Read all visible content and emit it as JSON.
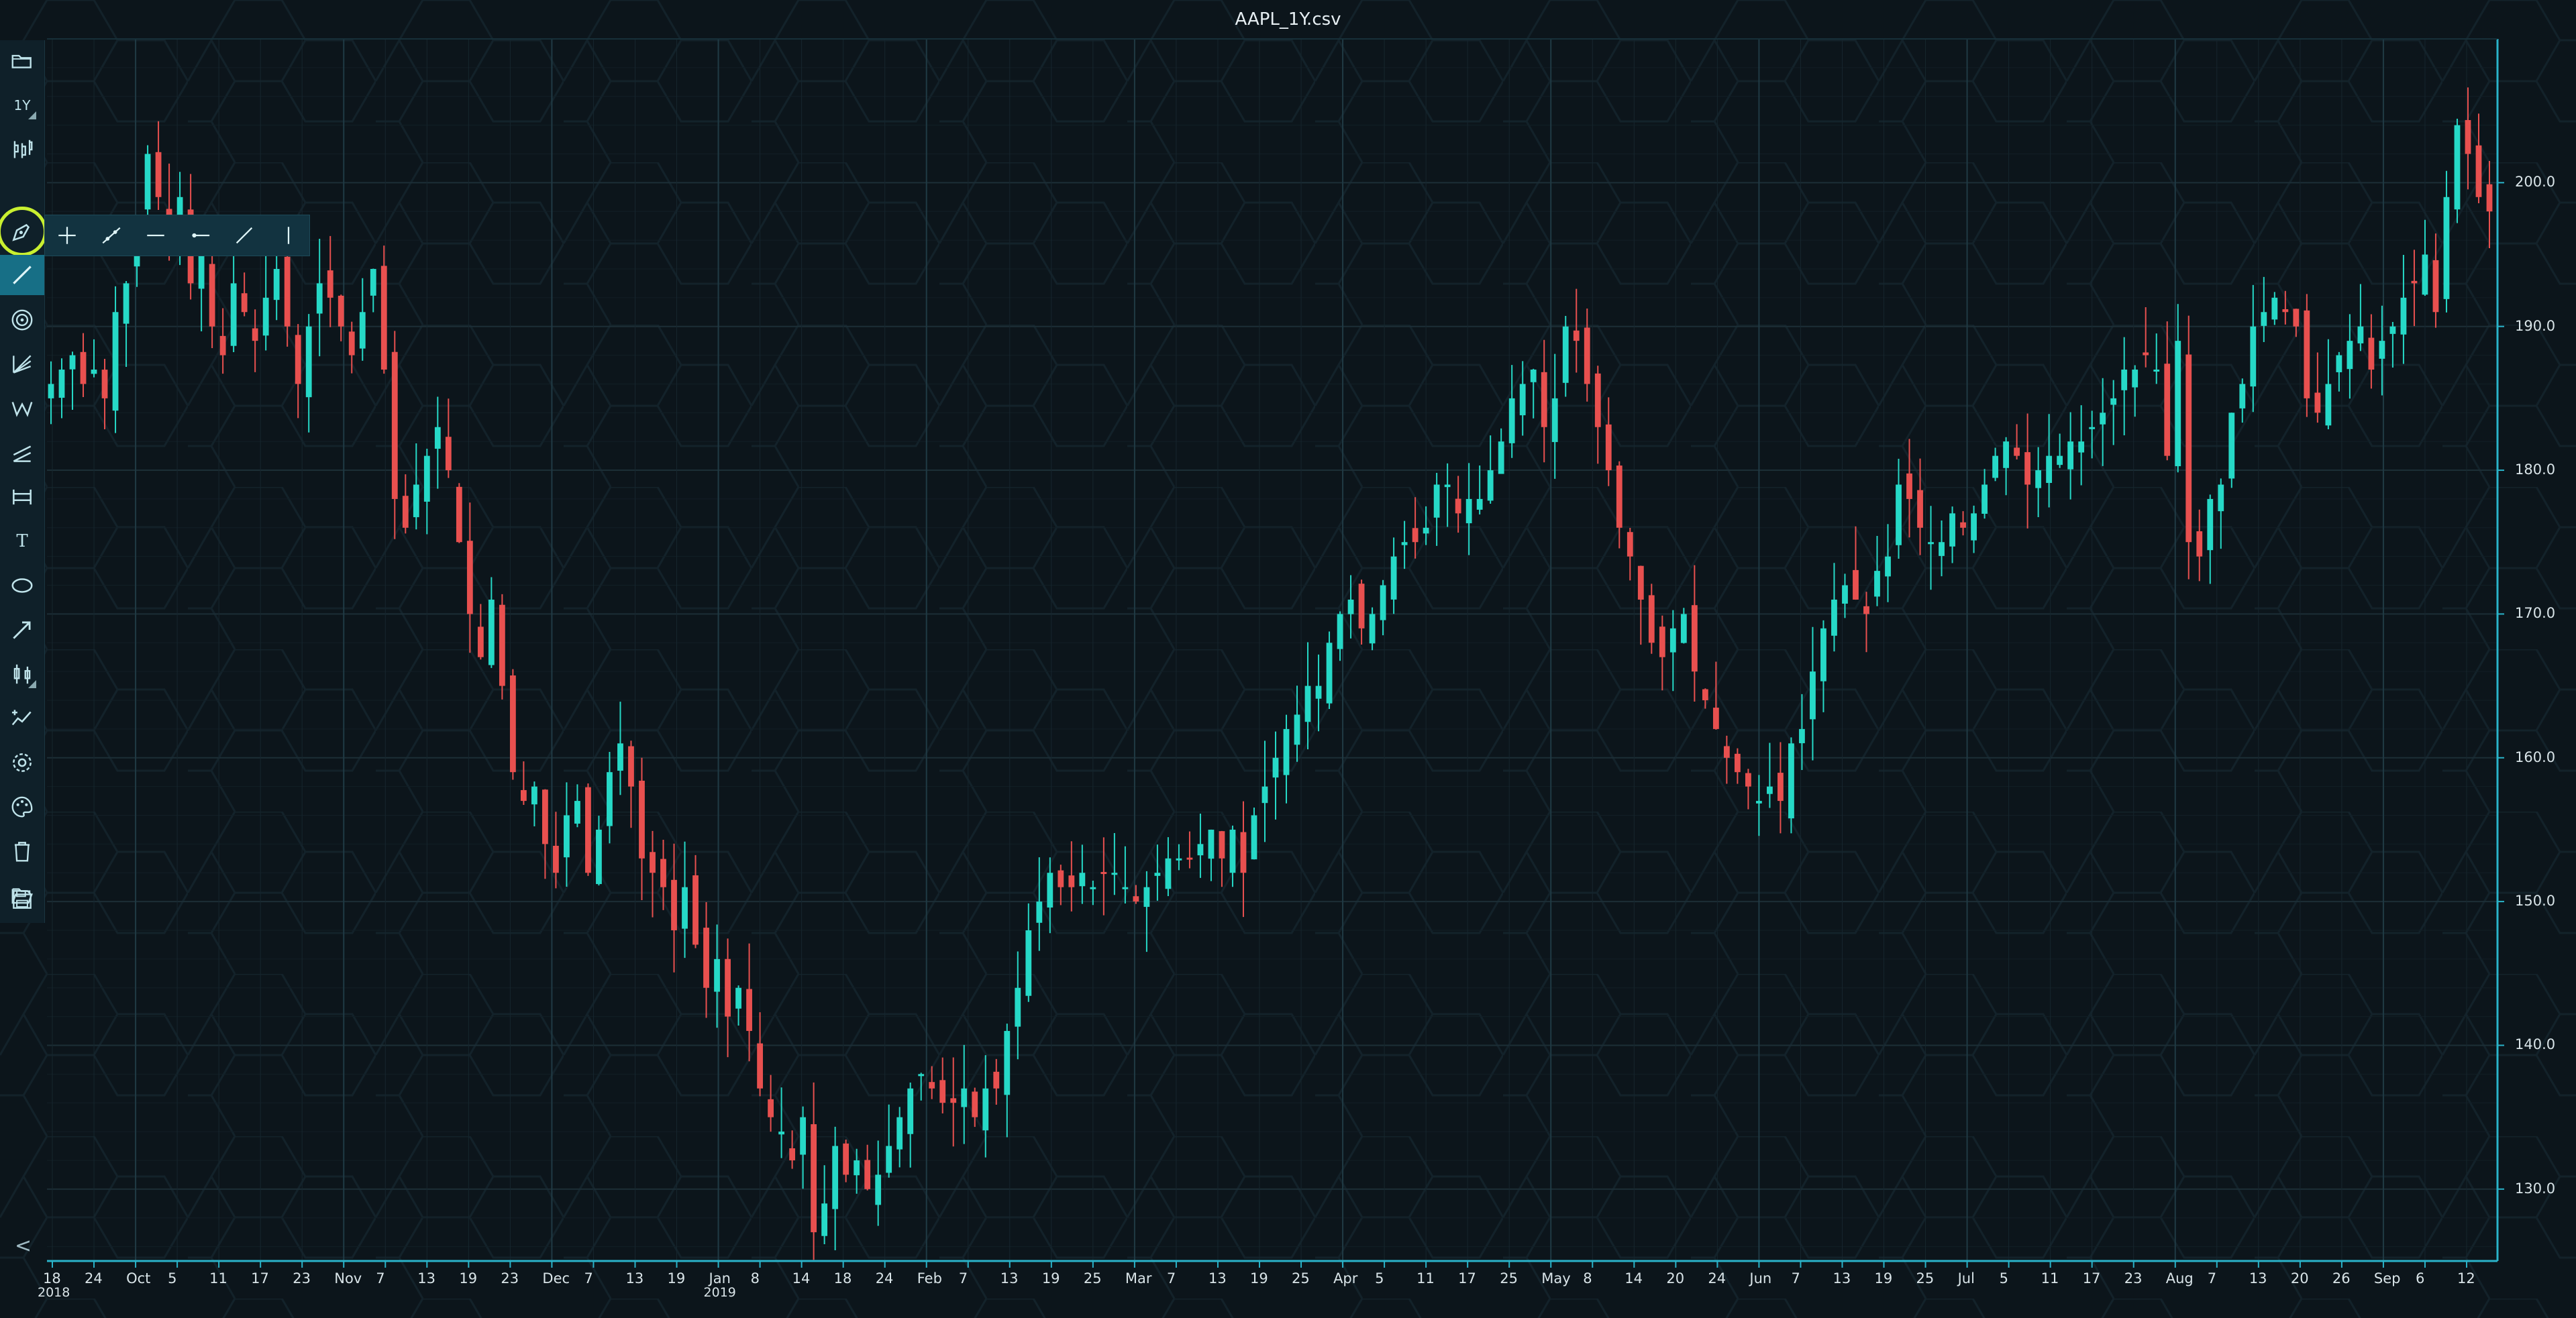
{
  "window": {
    "title": "AAPL_1Y.csv"
  },
  "toolbar": {
    "items": [
      {
        "name": "open-chart-icon",
        "label": ""
      },
      {
        "name": "timeframe-button",
        "label": "1Y"
      },
      {
        "name": "chart-type-icon",
        "label": ""
      },
      {
        "name": "drawing-tools-icon",
        "label": ""
      },
      {
        "name": "line-tool-icon",
        "label": ""
      },
      {
        "name": "fib-circle-icon",
        "label": ""
      },
      {
        "name": "fan-tool-icon",
        "label": ""
      },
      {
        "name": "wave-tool-icon",
        "label": ""
      },
      {
        "name": "channel-tool-icon",
        "label": ""
      },
      {
        "name": "range-tool-icon",
        "label": ""
      },
      {
        "name": "text-tool-icon",
        "label": "T"
      },
      {
        "name": "ellipse-tool-icon",
        "label": ""
      },
      {
        "name": "arrow-tool-icon",
        "label": ""
      },
      {
        "name": "candles-icon",
        "label": ""
      },
      {
        "name": "indicators-icon",
        "label": ""
      },
      {
        "name": "settings-icon",
        "label": ""
      },
      {
        "name": "palette-icon",
        "label": ""
      },
      {
        "name": "trash-icon",
        "label": ""
      },
      {
        "name": "folder-open-icon",
        "label": ""
      },
      {
        "name": "save-icon",
        "label": ""
      }
    ]
  },
  "subtoolbar": {
    "items": [
      "crosshair-icon",
      "segment-icon",
      "horizontal-line-icon",
      "horizontal-ray-icon",
      "trend-line-icon",
      "vertical-line-icon"
    ]
  },
  "collapse_label": "<",
  "colors": {
    "up": "#26d9c7",
    "down": "#e8504f",
    "grid": "#1c2e36",
    "axis": "#2ab3c9"
  },
  "chart_data": {
    "type": "candlestick",
    "title": "AAPL_1Y.csv",
    "ylim": [
      125,
      210
    ],
    "yticks": [
      "130.0",
      "140.0",
      "150.0",
      "160.0",
      "170.0",
      "180.0",
      "190.0",
      "200.0"
    ],
    "xticks": [
      {
        "label": "18",
        "year": "2018"
      },
      {
        "label": "24"
      },
      {
        "label": "Oct"
      },
      {
        "label": "5"
      },
      {
        "label": "11"
      },
      {
        "label": "17"
      },
      {
        "label": "23"
      },
      {
        "label": "Nov"
      },
      {
        "label": "7"
      },
      {
        "label": "13"
      },
      {
        "label": "19"
      },
      {
        "label": "23"
      },
      {
        "label": "Dec"
      },
      {
        "label": "7"
      },
      {
        "label": "13"
      },
      {
        "label": "19"
      },
      {
        "label": "Jan",
        "year": "2019"
      },
      {
        "label": "8"
      },
      {
        "label": "14"
      },
      {
        "label": "18"
      },
      {
        "label": "24"
      },
      {
        "label": "Feb"
      },
      {
        "label": "7"
      },
      {
        "label": "13"
      },
      {
        "label": "19"
      },
      {
        "label": "25"
      },
      {
        "label": "Mar"
      },
      {
        "label": "7"
      },
      {
        "label": "13"
      },
      {
        "label": "19"
      },
      {
        "label": "25"
      },
      {
        "label": "Apr"
      },
      {
        "label": "5"
      },
      {
        "label": "11"
      },
      {
        "label": "17"
      },
      {
        "label": "25"
      },
      {
        "label": "May"
      },
      {
        "label": "8"
      },
      {
        "label": "14"
      },
      {
        "label": "20"
      },
      {
        "label": "24"
      },
      {
        "label": "Jun"
      },
      {
        "label": "7"
      },
      {
        "label": "13"
      },
      {
        "label": "19"
      },
      {
        "label": "25"
      },
      {
        "label": "Jul"
      },
      {
        "label": "5"
      },
      {
        "label": "11"
      },
      {
        "label": "17"
      },
      {
        "label": "23"
      },
      {
        "label": "Aug"
      },
      {
        "label": "7"
      },
      {
        "label": "13"
      },
      {
        "label": "20"
      },
      {
        "label": "26"
      },
      {
        "label": "Sep"
      },
      {
        "label": "6"
      },
      {
        "label": "12"
      }
    ],
    "close_series": [
      186,
      187,
      188,
      186,
      187,
      185,
      191,
      193,
      197,
      202,
      199,
      196,
      199,
      193,
      195,
      190,
      188,
      193,
      191,
      189,
      192,
      194,
      190,
      186,
      190,
      193,
      192,
      190,
      188,
      191,
      194,
      187,
      178,
      176,
      179,
      181,
      183,
      180,
      175,
      170,
      167,
      171,
      165,
      159,
      157,
      158,
      154,
      152,
      156,
      157,
      152,
      155,
      159,
      161,
      158,
      153,
      152,
      151,
      148,
      151,
      147,
      144,
      146,
      142,
      144,
      141,
      137,
      135,
      134,
      132,
      135,
      127,
      129,
      133,
      131,
      132,
      130,
      131,
      133,
      135,
      137,
      138,
      137,
      136,
      136,
      137,
      135,
      137,
      137,
      141,
      144,
      148,
      150,
      152,
      151,
      151,
      152,
      151,
      152,
      152,
      151,
      150,
      151,
      152,
      153,
      153,
      153,
      154,
      155,
      153,
      155,
      152,
      156,
      158,
      160,
      162,
      163,
      165,
      165,
      168,
      170,
      171,
      169,
      170,
      172,
      174,
      175,
      175,
      176,
      179,
      179,
      177,
      178,
      178,
      180,
      182,
      185,
      186,
      187,
      183,
      185,
      190,
      189,
      186,
      183,
      180,
      176,
      174,
      171,
      168,
      167,
      169,
      170,
      166,
      164,
      162,
      160,
      159,
      158,
      157,
      158,
      157,
      161,
      162,
      166,
      169,
      171,
      172,
      171,
      170,
      173,
      174,
      179,
      178,
      176,
      175,
      175,
      177,
      176,
      177,
      179,
      181,
      182,
      181,
      179,
      180,
      181,
      181,
      182,
      182,
      183,
      184,
      185,
      187,
      187,
      188,
      187,
      181,
      189,
      175,
      174,
      178,
      179,
      184,
      186,
      190,
      191,
      192,
      191,
      190,
      185,
      184,
      186,
      188,
      189,
      190,
      187,
      189,
      190,
      192,
      193,
      195,
      191,
      199,
      204,
      202,
      199,
      198
    ]
  }
}
